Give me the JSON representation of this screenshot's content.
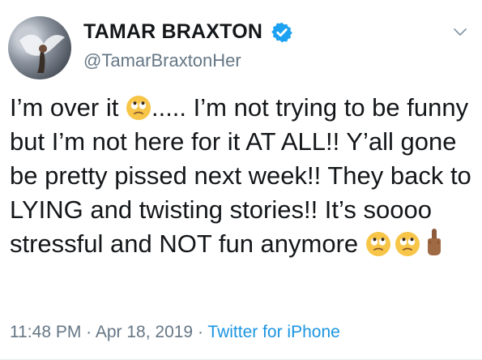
{
  "author": {
    "display_name": "TAMAR BRAXTON",
    "handle": "@TamarBraxtonHer",
    "verified": true,
    "avatar_icon": "avatar-dove-icon"
  },
  "tweet": {
    "segments": {
      "s1": "I’m over it ",
      "s2": "..... I’m not trying to be funny but I’m not here for it AT ALL!! Y’all gone be pretty pissed next week!! They back to LYING and twisting stories!! It’s soooo stressful and NOT fun anymore "
    },
    "emojis": [
      "face-with-rolling-eyes-icon",
      "face-with-rolling-eyes-icon",
      "face-with-rolling-eyes-icon",
      "middle-finger-icon"
    ]
  },
  "meta": {
    "time": "11:48 PM",
    "sep1": " · ",
    "date": "Apr 18, 2019",
    "sep2": " · ",
    "source": "Twitter for iPhone"
  },
  "colors": {
    "text": "#14171a",
    "secondary": "#657786",
    "link": "#1b95e0",
    "verified": "#1da1f2"
  }
}
